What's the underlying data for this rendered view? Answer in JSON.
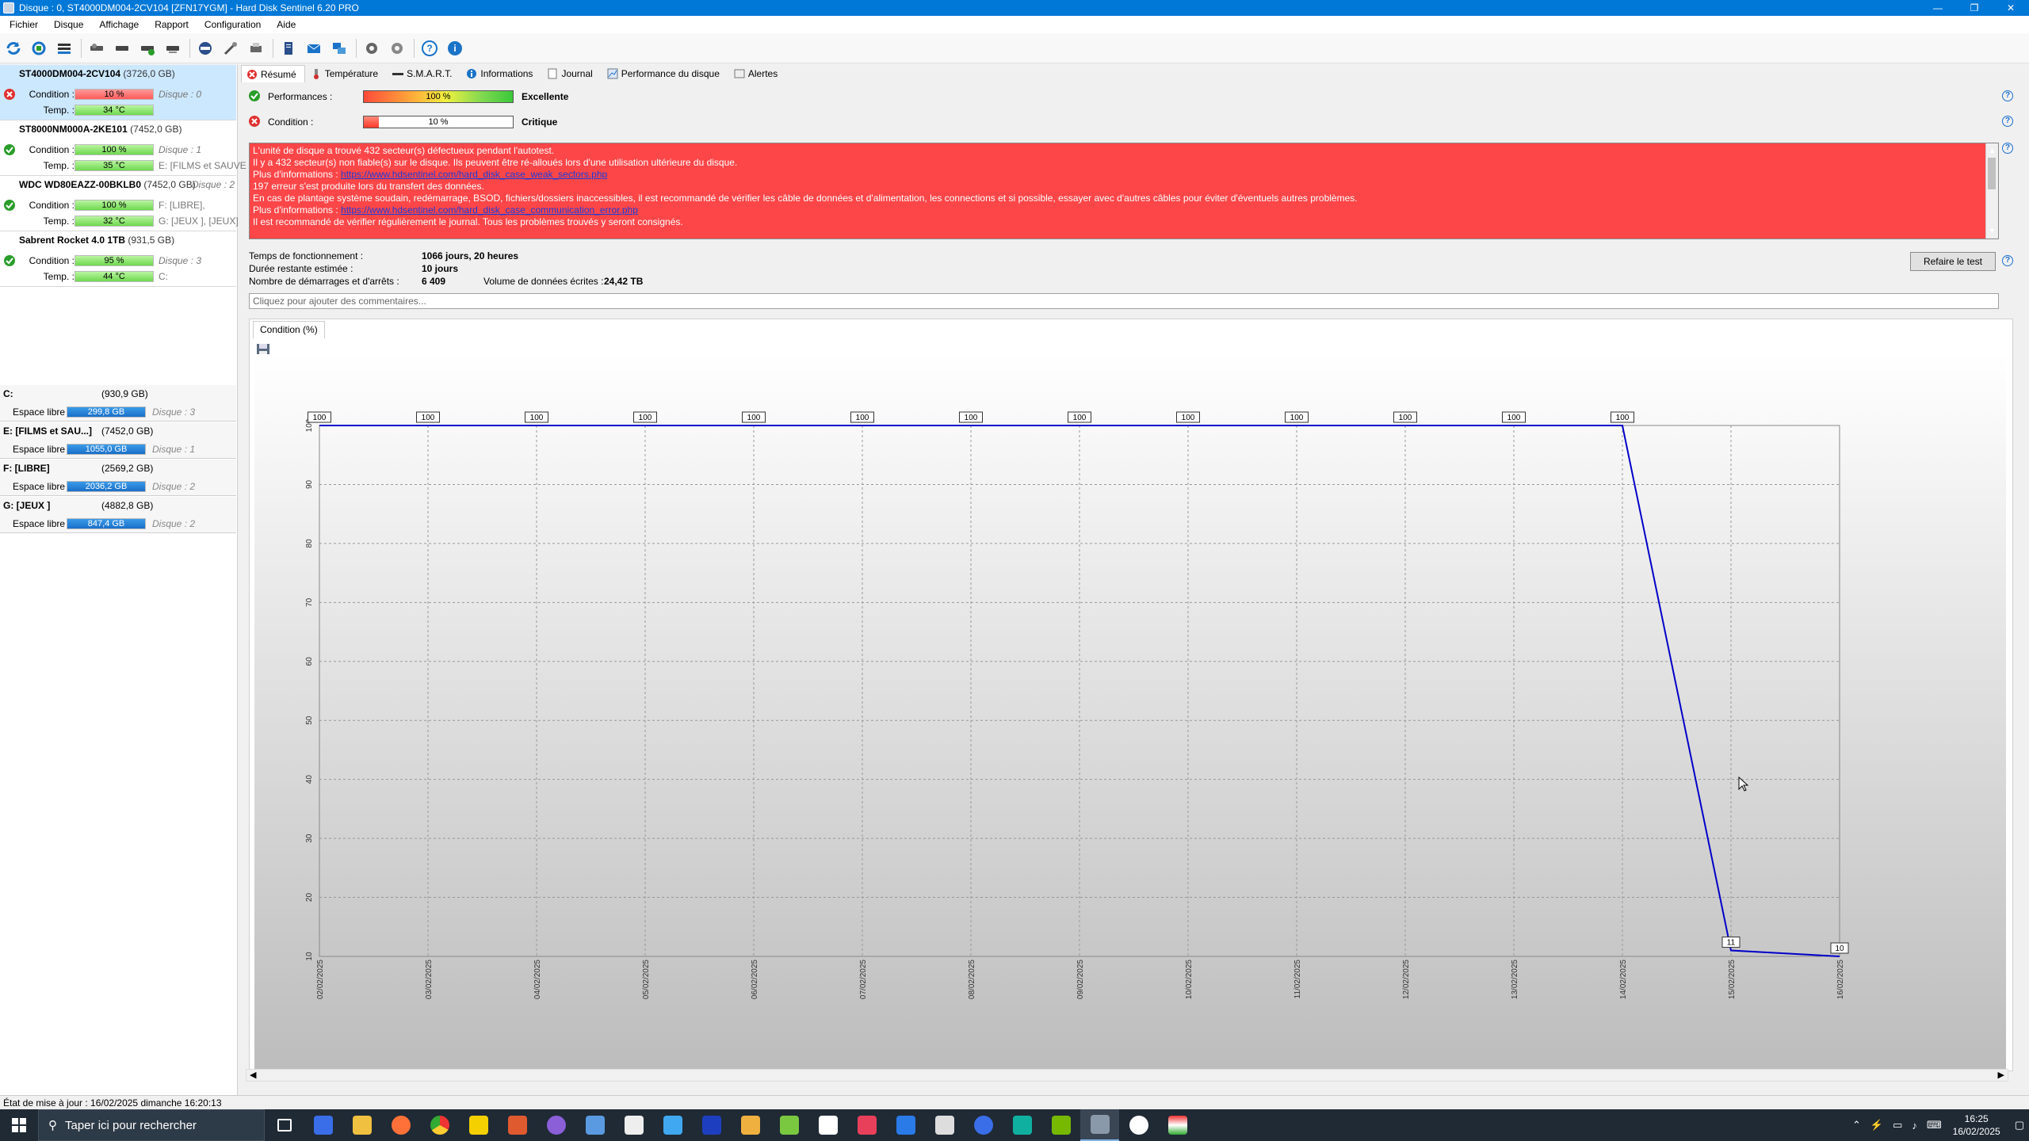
{
  "window": {
    "title": "Disque : 0, ST4000DM004-2CV104 [ZFN17YGM]  -  Hard Disk Sentinel 6.20 PRO",
    "minimize": "—",
    "maximize": "❐",
    "close": "✕"
  },
  "menu": [
    "Fichier",
    "Disque",
    "Affichage",
    "Rapport",
    "Configuration",
    "Aide"
  ],
  "disks": [
    {
      "name": "ST4000DM004-2CV104",
      "size": "(3726,0 GB)",
      "condition_label": "Condition :",
      "condition": "10 %",
      "condition_value": 10,
      "temp_label": "Temp. :",
      "temp": "34 °C",
      "info1": "Disque : 0",
      "info2": "",
      "status": "error"
    },
    {
      "name": "ST8000NM000A-2KE101",
      "size": "(7452,0 GB)",
      "condition_label": "Condition :",
      "condition": "100 %",
      "condition_value": 100,
      "temp_label": "Temp. :",
      "temp": "35 °C",
      "info1": "Disque : 1",
      "info2": "E: [FILMS et SAUVE",
      "status": "ok"
    },
    {
      "name": "WDC WD80EAZZ-00BKLB0",
      "size": "(7452,0 GB)",
      "condition_label": "Condition :",
      "condition": "100 %",
      "condition_value": 100,
      "temp_label": "Temp. :",
      "temp": "32 °C",
      "info1": "F: [LIBRE],",
      "info2": "G: [JEUX ], [JEUX]",
      "info0": "Disque : 2",
      "status": "ok"
    },
    {
      "name": "Sabrent Rocket 4.0 1TB",
      "size": "(931,5 GB)",
      "condition_label": "Condition :",
      "condition": "95 %",
      "condition_value": 95,
      "temp_label": "Temp. :",
      "temp": "44 °C",
      "info1": "Disque : 3",
      "info2": "C:",
      "status": "ok"
    }
  ],
  "volumes": [
    {
      "name": "C:",
      "size": "(930,9 GB)",
      "free_label": "Espace libre",
      "free": "299,8 GB",
      "free_fraction": 0.32,
      "disk": "Disque : 3"
    },
    {
      "name": "E: [FILMS et SAU...]",
      "size": "(7452,0 GB)",
      "free_label": "Espace libre",
      "free": "1055,0 GB",
      "free_fraction": 0.14,
      "disk": "Disque : 1"
    },
    {
      "name": "F: [LIBRE]",
      "size": "(2569,2 GB)",
      "free_label": "Espace libre",
      "free": "2036,2 GB",
      "free_fraction": 0.79,
      "disk": "Disque : 2"
    },
    {
      "name": "G: [JEUX ]",
      "size": "(4882,8 GB)",
      "free_label": "Espace libre",
      "free": "847,4 GB",
      "free_fraction": 0.17,
      "disk": "Disque : 2"
    }
  ],
  "tabs": [
    {
      "label": "Résumé",
      "icon": "error-icon",
      "active": true
    },
    {
      "label": "Température",
      "icon": "thermometer-icon"
    },
    {
      "label": "S.M.A.R.T.",
      "icon": "smart-icon"
    },
    {
      "label": "Informations",
      "icon": "info-icon"
    },
    {
      "label": "Journal",
      "icon": "journal-icon"
    },
    {
      "label": "Performance du disque",
      "icon": "performance-icon"
    },
    {
      "label": "Alertes",
      "icon": "alerts-icon"
    }
  ],
  "summary": {
    "performance_label": "Performances :",
    "performance_value": "100 %",
    "performance_fraction": 1.0,
    "performance_text": "Excellente",
    "condition_label": "Condition :",
    "condition_value": "10 %",
    "condition_fraction": 0.1,
    "condition_text": "Critique"
  },
  "message": {
    "l1": "L'unité de disque a trouvé 432 secteur(s) défectueux pendant l'autotest.",
    "l2": "Il y a 432 secteur(s) non fiable(s) sur le disque. Ils peuvent être ré-alloués lors d'une utilisation ultérieure du disque.",
    "l3_pre": "Plus d'informations : ",
    "l3_link": "https://www.hdsentinel.com/hard_disk_case_weak_sectors.php",
    "l4": "197 erreur s'est produite lors du transfert des données.",
    "l5": "En cas de plantage système soudain, redémarrage, BSOD, fichiers/dossiers inaccessibles, il est recommandé de vérifier les câble de données et d'alimentation, les connections et si possible, essayer avec d'autres câbles pour éviter d'éventuels autres problèmes.",
    "l6_pre": "Plus d'informations : ",
    "l6_link": "https://www.hdsentinel.com/hard_disk_case_communication_error.php",
    "l7": "Il est recommandé de vérifier régulièrement le journal. Tous les problèmes trouvés y seront consignés."
  },
  "stats": {
    "uptime_label": "Temps de fonctionnement :",
    "uptime": "1066 jours, 20 heures",
    "remaining_label": "Durée restante estimée :",
    "remaining": "10 jours",
    "starts_label": "Nombre de démarrages et d'arrêts :",
    "starts": "6 409",
    "written_label": "Volume de données écrites :",
    "written": "24,42 TB"
  },
  "retest_button": "Refaire le test",
  "comment_placeholder": "Cliquez pour ajouter des commentaires...",
  "graph_tab": "Condition (%)",
  "chart_data": {
    "type": "line",
    "x": [
      "02/02/2025",
      "03/02/2025",
      "04/02/2025",
      "05/02/2025",
      "06/02/2025",
      "07/02/2025",
      "08/02/2025",
      "09/02/2025",
      "10/02/2025",
      "11/02/2025",
      "12/02/2025",
      "13/02/2025",
      "14/02/2025",
      "15/02/2025",
      "16/02/2025"
    ],
    "values": [
      100,
      100,
      100,
      100,
      100,
      100,
      100,
      100,
      100,
      100,
      100,
      100,
      100,
      11,
      10
    ],
    "yticks": [
      10,
      20,
      30,
      40,
      50,
      60,
      70,
      80,
      90,
      100
    ],
    "ylim": [
      10,
      100
    ],
    "grid": true,
    "line_color": "#0000c8"
  },
  "statusbar": "État de mise à jour : 16/02/2025 dimanche 16:20:13",
  "taskbar": {
    "search_placeholder": "Taper ici pour rechercher",
    "time": "16:25",
    "date": "16/02/2025"
  }
}
